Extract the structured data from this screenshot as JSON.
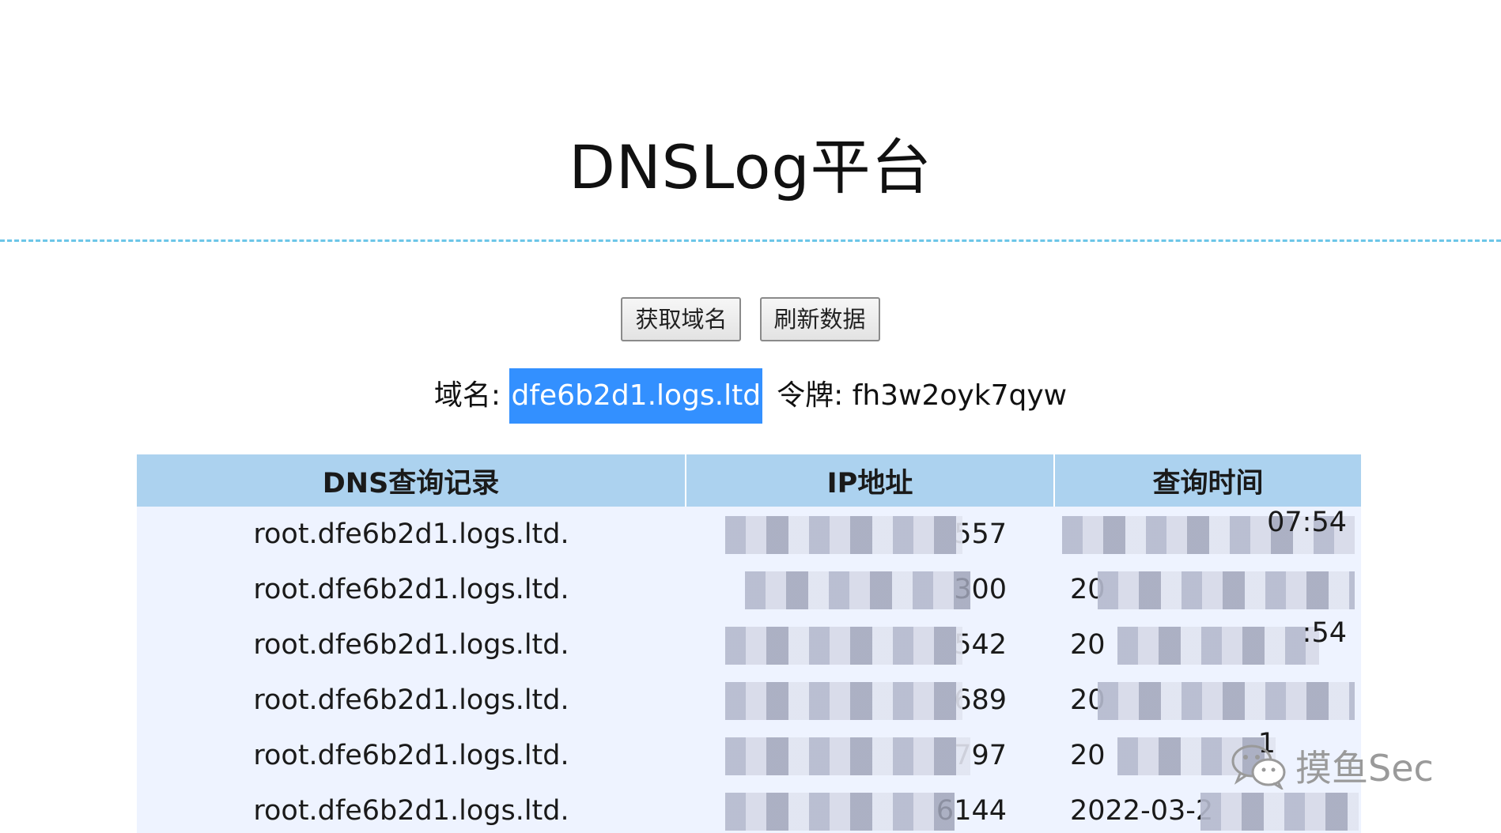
{
  "page": {
    "title": "DNSLog平台"
  },
  "buttons": {
    "get_domain": "获取域名",
    "refresh": "刷新数据"
  },
  "info": {
    "domain_label": "域名: ",
    "domain_value": "dfe6b2d1.logs.ltd",
    "token_label": "令牌: ",
    "token_value": "fh3w2oyk7qyw"
  },
  "table": {
    "headers": [
      "DNS查询记录",
      "IP地址",
      "查询时间"
    ],
    "rows": [
      {
        "record": "root.dfe6b2d1.logs.ltd.",
        "ip": "557",
        "time": "",
        "time_end": "07:54"
      },
      {
        "record": "root.dfe6b2d1.logs.ltd.",
        "ip": "300",
        "time": "20",
        "time_end": ""
      },
      {
        "record": "root.dfe6b2d1.logs.ltd.",
        "ip": "542",
        "time": "20",
        "time_end": ":54"
      },
      {
        "record": "root.dfe6b2d1.logs.ltd.",
        "ip": "689",
        "time": "20",
        "time_end": ""
      },
      {
        "record": "root.dfe6b2d1.logs.ltd.",
        "ip": "797",
        "time": "20",
        "time_end": "1"
      },
      {
        "record": "root.dfe6b2d1.logs.ltd.",
        "ip": "6144",
        "time": "2022-03-2",
        "time_end": ""
      }
    ]
  },
  "watermark": {
    "icon": "wechat-icon",
    "text": "摸鱼Sec"
  }
}
